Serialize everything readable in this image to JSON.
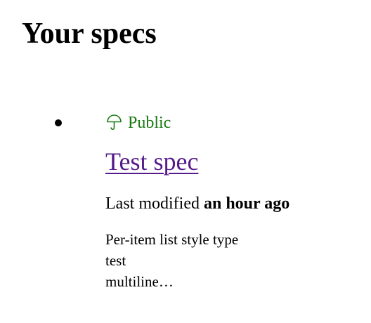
{
  "page": {
    "title": "Your specs"
  },
  "colors": {
    "public_green": "#1a7a12",
    "link_visited": "#551a8b"
  },
  "specs": [
    {
      "visibility_icon": "umbrella-icon",
      "visibility": "Public",
      "title": "Test spec",
      "modified_prefix": "Last modified",
      "modified_when": "an hour ago",
      "description_lines": [
        "Per-item list style type",
        "test",
        "multiline…"
      ]
    }
  ]
}
